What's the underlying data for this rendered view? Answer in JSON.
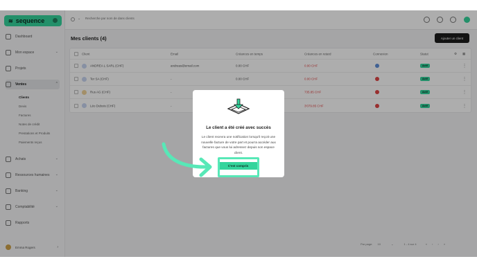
{
  "brand": {
    "name": "sequence",
    "mark": "≋",
    "accent": "#34d49c"
  },
  "sidebar": {
    "items": [
      {
        "label": "Dashboard",
        "icon": "home-icon"
      },
      {
        "label": "Mon espace",
        "icon": "user-icon"
      },
      {
        "label": "Projets",
        "icon": "checkbox-icon"
      },
      {
        "label": "Ventes",
        "icon": "bag-icon"
      },
      {
        "label": "Achats",
        "icon": "basket-icon"
      },
      {
        "label": "Ressources humaines",
        "icon": "people-icon"
      },
      {
        "label": "Banking",
        "icon": "bank-icon"
      },
      {
        "label": "Comptabilité",
        "icon": "calculator-icon"
      },
      {
        "label": "Rapports",
        "icon": "chart-icon"
      }
    ],
    "sub_items": [
      "Clients",
      "Devis",
      "Factures",
      "Notes de crédit",
      "Prestations et Produits",
      "Paiements reçus"
    ],
    "user": "Emma Rogers"
  },
  "search": {
    "placeholder": "Recherche par nom de dans clients"
  },
  "main": {
    "title": "Mes clients (4)",
    "add_button": "Ajouter un client",
    "columns": [
      "Client",
      "Email",
      "Créances en temps",
      "Créances en retard",
      "Connexion",
      "Statut"
    ],
    "rows": [
      {
        "initials": "AL",
        "client": "ANDREA L SARL (CHF)",
        "email": "andreas@email.com",
        "on_time": "0.00 CHF",
        "late": "0.00 CHF",
        "status": "Actif",
        "connected": true
      },
      {
        "initials": "TS",
        "client": "Ter SA (CHF)",
        "email": "-",
        "on_time": "0.00 CHF",
        "late": "0.00 CHF",
        "status": "Actif",
        "connected": false
      },
      {
        "initials": "RA",
        "client": "Rus AG (CHF)",
        "email": "-",
        "on_time": "0.00 CHF",
        "late": "735.85 CHF",
        "status": "Actif",
        "connected": false
      },
      {
        "initials": "LD",
        "client": "Léo Dubois (CHF)",
        "email": "-",
        "on_time": "0.00 CHF",
        "late": "3'079.85 CHF",
        "status": "Actif",
        "connected": false
      }
    ],
    "pagination": {
      "per_page_label": "Par page:",
      "per_page": "10",
      "range": "1 - 4 sur 4"
    }
  },
  "modal": {
    "title": "Le client a été créé avec succès",
    "text": "Le client recevra une notification lorsqu'il reçoit une nouvelle facture de votre part et pourra accéder aux factures que vous lui adressez depuis son espace client.",
    "button": "C'est compris"
  }
}
